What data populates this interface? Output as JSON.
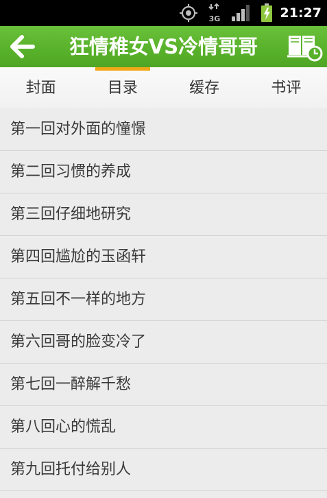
{
  "status_bar": {
    "time": "21:27",
    "network_label": "3G",
    "icons": [
      "gps-icon",
      "network-3g-icon",
      "signal-icon",
      "battery-charging-icon"
    ]
  },
  "header": {
    "title": "狂情稚女VS冷情哥哥",
    "back_icon": "back-arrow-icon",
    "bookshelf_icon": "bookshelf-history-icon",
    "color": "#58b12a"
  },
  "tabs": [
    {
      "label": "封面",
      "active": false
    },
    {
      "label": "目录",
      "active": true
    },
    {
      "label": "缓存",
      "active": false
    },
    {
      "label": "书评",
      "active": false
    }
  ],
  "tab_indicator_color": "#f0a818",
  "chapters": [
    "第一回对外面的憧憬",
    "第二回习惯的养成",
    "第三回仔细地研究",
    "第四回尴尬的玉函轩",
    "第五回不一样的地方",
    "第六回哥的脸变冷了",
    "第七回一醉解千愁",
    "第八回心的慌乱",
    "第九回托付给别人"
  ]
}
